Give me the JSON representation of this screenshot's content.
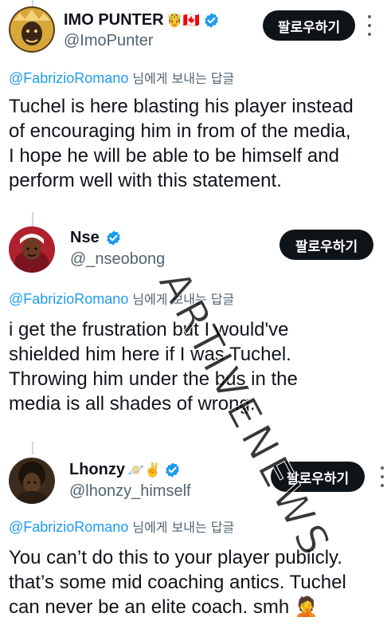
{
  "colors": {
    "text": "#0f1419",
    "secondary": "#536471",
    "link": "#1d9bf0",
    "verified": "#1d9bf0",
    "button_bg": "#0f1419",
    "button_text": "#ffffff"
  },
  "tweets": [
    {
      "display_name": "IMO PUNTER",
      "emojis": "🤴🇨🇦",
      "verified": true,
      "handle": "@ImoPunter",
      "follow_label": "팔로우하기",
      "reply_mention": "@FabrizioRomano",
      "reply_suffix": "님에게 보내는 답글",
      "lines": [
        "Tuchel is here blasting his player instead",
        "of encouraging him in from of the media,",
        "I hope he will be able to be himself and",
        "perform well with this statement."
      ]
    },
    {
      "display_name": "Nse",
      "emojis": "",
      "verified": true,
      "handle": "@_nseobong",
      "follow_label": "팔로우하기",
      "reply_mention": "@FabrizioRomano",
      "reply_suffix": "님에게 보내는 답글",
      "lines": [
        "i get the frustration but I would've",
        "shielded him here if I was Tuchel.",
        "Throwing him under the bus in the",
        "media is all shades of wrong."
      ]
    },
    {
      "display_name": "Lhonzy",
      "emojis": "🪐✌️",
      "verified": true,
      "handle": "@lhonzy_himself",
      "follow_label": "팔로우하기",
      "reply_mention": "@FabrizioRomano",
      "reply_suffix": "님에게 보내는 답글",
      "lines": [
        "You can’t do this to your player publicly.",
        "that’s some mid coaching antics. Tuchel",
        "can never be an elite coach. smh 🤦"
      ]
    }
  ],
  "watermark": "ARTIVENEWS"
}
